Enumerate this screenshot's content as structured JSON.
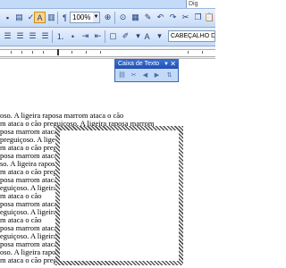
{
  "menu": {
    "help_box_text": "Dig"
  },
  "standard_toolbar": {
    "zoom_value": "100%",
    "icons": [
      "save-icon",
      "print-icon",
      "spell-check-icon",
      "cut-icon",
      "copy-icon",
      "paste-icon",
      "undo-icon",
      "redo-icon",
      "link-icon",
      "table-icon",
      "columns-icon",
      "drawing-icon",
      "text-box-icon",
      "pilcrow-icon",
      "zoom-icon"
    ]
  },
  "formatting_toolbar": {
    "style_value": "CABEÇALHO DA",
    "icons": [
      "align-left-icon",
      "align-center-icon",
      "align-right-icon",
      "justify-icon",
      "numbering-icon",
      "bullets-icon",
      "indent-icon",
      "border-icon",
      "highlight-icon",
      "font-color-icon"
    ]
  },
  "textbox_toolbar": {
    "title": "Caixa de Texto",
    "buttons": [
      "create-link-icon",
      "break-link-icon",
      "previous-text-box-icon",
      "next-text-box-icon",
      "text-direction-icon"
    ]
  },
  "document": {
    "lines": [
      "oso.  A ligeira raposa marrom ataca o cão",
      "m ataca o cão preguiçoso.  A ligeira raposa marrom",
      "posa marrom ataca o cão preguiçoso.",
      "preguiçoso.  A ligeira raposa marrom ataca o cão",
      "m ataca o cão preguiçoso.  A ligeira raposa marrom",
      "posa marrom ataca o cão preguiçoso.  A ligeira",
      "so.  A ligeira raposa marrom ataca o cão",
      "m ataca o cão preguiçoso.  A ligeira",
      "posa marrom ataca o cão",
      "eguiçoso.  A ligeira",
      "m ataca o cão",
      "posa marrom ataca o cão",
      "eguiçoso.  A ligeira",
      "m ataca o cão",
      "posa marrom ataca o cão",
      "eguiçoso.  A ligeira",
      "posa marrom ataca o cão preguiçoso.",
      "oso.  A ligeira raposa marrom ataca o cão",
      "m ataca o cão preguiçoso.  A ligeira raposa marrom",
      "posa marrom ataca o cão preguiçoso.  A ligeira"
    ]
  }
}
